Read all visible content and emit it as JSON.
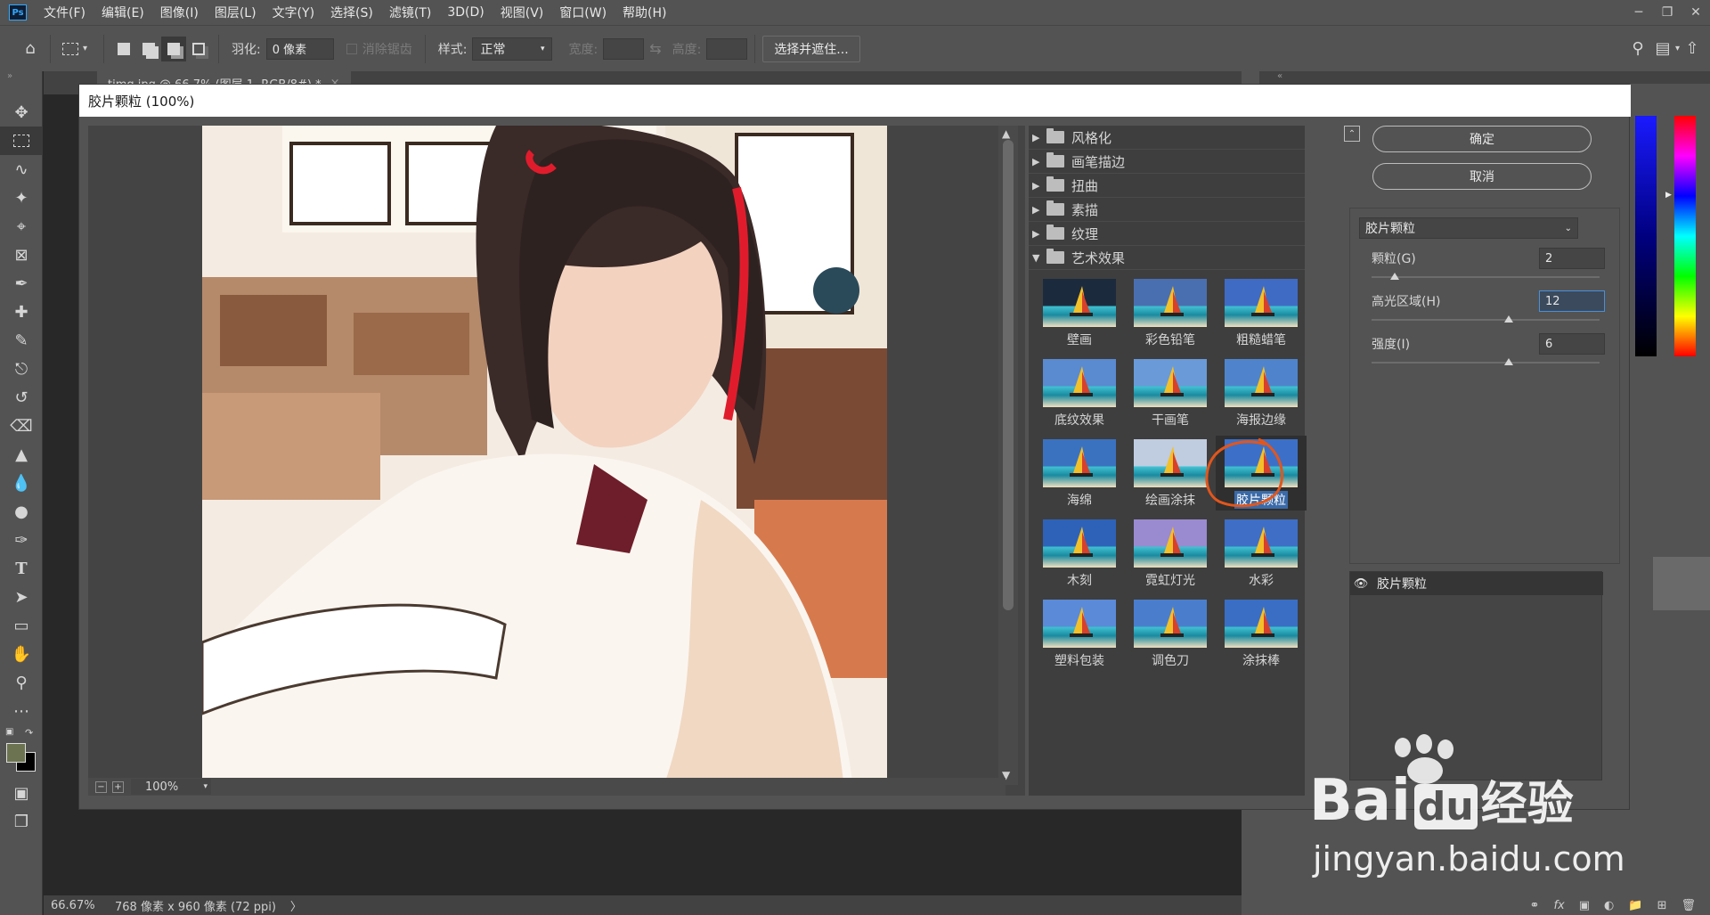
{
  "menu": [
    "文件(F)",
    "编辑(E)",
    "图像(I)",
    "图层(L)",
    "文字(Y)",
    "选择(S)",
    "滤镜(T)",
    "3D(D)",
    "视图(V)",
    "窗口(W)",
    "帮助(H)"
  ],
  "window_controls": [
    "minimize-icon",
    "restore-icon",
    "close-icon"
  ],
  "options": {
    "feather_label": "羽化:",
    "feather_value": "0 像素",
    "antialias_label": "消除锯齿",
    "style_label": "样式:",
    "style_value": "正常",
    "width_label": "宽度:",
    "height_label": "高度:",
    "select_mask_button": "选择并遮住..."
  },
  "doc_tab": "timg.jpg @ 66.7% (图层 1, RGB/8#) *",
  "status": {
    "zoom": "66.67%",
    "info": "768 像素 x 960 像素 (72 ppi)",
    "arrow": "〉"
  },
  "dialog": {
    "title": "胶片颗粒 (100%)",
    "zoom_value": "100%",
    "categories": [
      {
        "label": "风格化",
        "expanded": false
      },
      {
        "label": "画笔描边",
        "expanded": false
      },
      {
        "label": "扭曲",
        "expanded": false
      },
      {
        "label": "素描",
        "expanded": false
      },
      {
        "label": "纹理",
        "expanded": false
      },
      {
        "label": "艺术效果",
        "expanded": true
      }
    ],
    "filters": [
      "壁画",
      "彩色铅笔",
      "粗糙蜡笔",
      "底纹效果",
      "干画笔",
      "海报边缘",
      "海绵",
      "绘画涂抹",
      "胶片颗粒",
      "木刻",
      "霓虹灯光",
      "水彩",
      "塑料包装",
      "调色刀",
      "涂抹棒"
    ],
    "selected_filter": "胶片颗粒",
    "ok_button": "确定",
    "cancel_button": "取消",
    "filter_select": "胶片颗粒",
    "params": [
      {
        "label": "颗粒(G)",
        "value": "2",
        "fraction": 0.1
      },
      {
        "label": "高光区域(H)",
        "value": "12",
        "fraction": 0.6
      },
      {
        "label": "强度(I)",
        "value": "6",
        "fraction": 0.6
      }
    ],
    "applied_layer": "胶片颗粒"
  },
  "watermark": {
    "brand": "Bai",
    "du": "du",
    "cn": "经验",
    "url": "jingyan.baidu.com"
  },
  "colors": {
    "accent_blue": "#31a8ff",
    "selection_circle": "#e2561c",
    "panel": "#535353",
    "dark_panel": "#424242",
    "foreground_swatch": "#6b7350",
    "background_swatch": "#000000"
  }
}
